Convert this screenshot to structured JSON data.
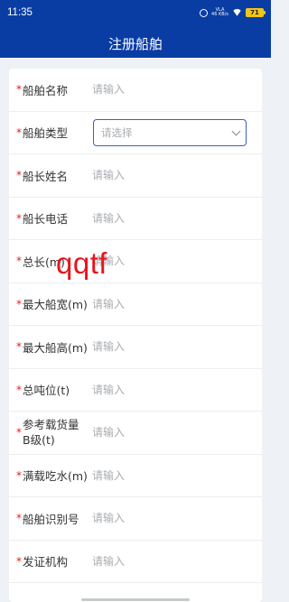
{
  "status": {
    "time": "11:35",
    "net_top": "VLA",
    "net_mid": "46 KB/s",
    "battery": "71"
  },
  "header": {
    "title": "注册船舶"
  },
  "form": {
    "placeholder": "请输入",
    "select_placeholder": "请选择",
    "fields": [
      {
        "label": "船舶名称",
        "required": "*"
      },
      {
        "label": "船舶类型",
        "required": "*"
      },
      {
        "label": "船长姓名",
        "required": "*"
      },
      {
        "label": "船长电话",
        "required": "*"
      },
      {
        "label": "总长(m)",
        "required": "*"
      },
      {
        "label": "最大船宽(m)",
        "required": "*"
      },
      {
        "label": "最大船高(m)",
        "required": "*"
      },
      {
        "label": "总吨位(t)",
        "required": "*"
      },
      {
        "label": "参考载货量B级(t)",
        "required": "*"
      },
      {
        "label": "满载吃水(m)",
        "required": "*"
      },
      {
        "label": "船舶识别号",
        "required": "*"
      },
      {
        "label": "发证机构",
        "required": "*"
      }
    ]
  },
  "watermark": {
    "text": "qqtf"
  }
}
